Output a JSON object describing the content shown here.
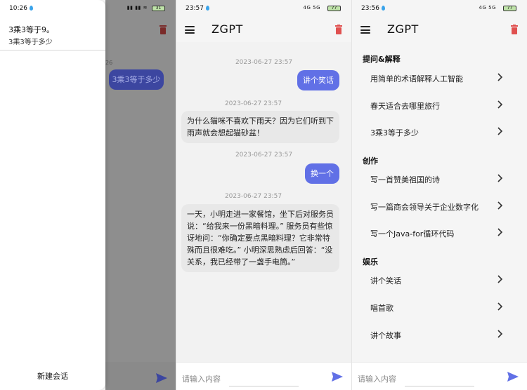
{
  "panel1": {
    "status": {
      "time": "10:26",
      "battery": "31"
    },
    "conversation": {
      "answer": "3乘3等于9。",
      "question": "3乘3等于多少"
    },
    "background_time": "26",
    "background_bubble": "3乘3等于多少",
    "new_conversation": "新建会话"
  },
  "panel2": {
    "status": {
      "time": "23:57",
      "signal": "4G 5G",
      "battery": "77"
    },
    "title": "ZGPT",
    "messages": [
      {
        "time": "2023-06-27 23:57",
        "role": "me",
        "text": "讲个笑话"
      },
      {
        "time": "2023-06-27 23:57",
        "role": "bot",
        "text": "为什么猫咪不喜欢下雨天？因为它们听到下雨声就会想起猫砂盆！"
      },
      {
        "time": "2023-06-27 23:57",
        "role": "me",
        "text": "换一个"
      },
      {
        "time": "2023-06-27 23:57",
        "role": "bot",
        "text": "一天，小明走进一家餐馆，坐下后对服务员说：“给我来一份黑暗料理。” 服务员有些惊讶地问：“你确定要点黑暗料理？它非常特殊而且很难吃。” 小明深思熟虑后回答：“没关系，我已经带了一盏手电筒。”"
      }
    ],
    "input_placeholder": "请输入内容"
  },
  "panel3": {
    "status": {
      "time": "23:56",
      "signal": "4G 5G",
      "battery": "77"
    },
    "title": "ZGPT",
    "sections": [
      {
        "title": "提问&解释",
        "items": [
          "用简单的术语解释人工智能",
          "春天适合去哪里旅行",
          "3乘3等于多少"
        ]
      },
      {
        "title": "创作",
        "items": [
          "写一首赞美祖国的诗",
          "写一篇商会领导关于企业数字化",
          "写一个Java-for循环代码"
        ]
      },
      {
        "title": "娱乐",
        "items": [
          "讲个笑话",
          "唱首歌",
          "讲个故事"
        ]
      }
    ],
    "input_placeholder": "请输入内容"
  },
  "colors": {
    "accent": "#6170e6",
    "delete": "#e0504f",
    "bot_bubble": "#e8e8e8"
  }
}
